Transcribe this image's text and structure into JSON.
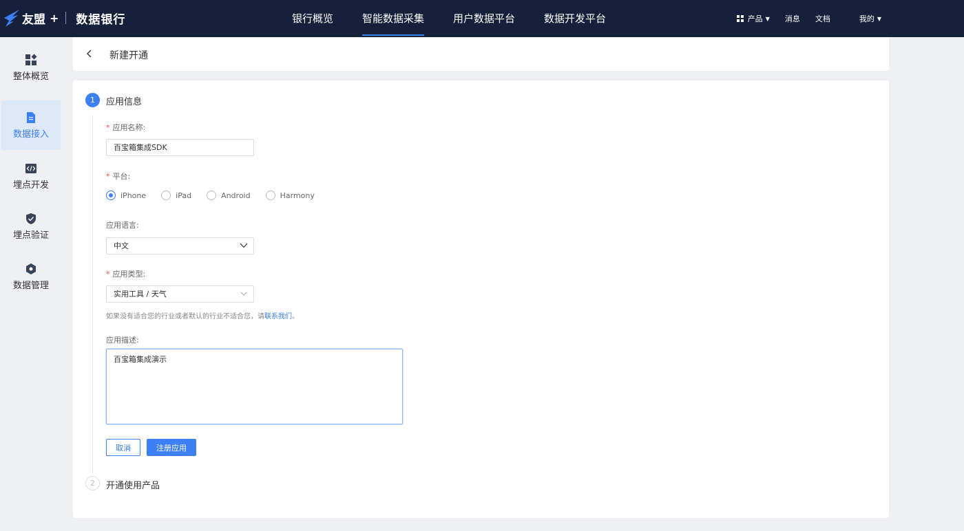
{
  "topbar": {
    "brand": "友盟",
    "brand_plus": "+",
    "product_name": "数据银行",
    "nav": [
      {
        "label": "银行概览",
        "active": false
      },
      {
        "label": "智能数据采集",
        "active": true
      },
      {
        "label": "用户数据平台",
        "active": false
      },
      {
        "label": "数据开发平台",
        "active": false
      }
    ],
    "products_label": "产品",
    "messages_label": "消息",
    "docs_label": "文档",
    "me_label": "我的",
    "accent_color": "#3d7ff5"
  },
  "sidebar": {
    "items": [
      {
        "label": "整体概览",
        "icon": "dashboard-icon",
        "active": false
      },
      {
        "label": "数据接入",
        "icon": "document-icon",
        "active": true
      },
      {
        "label": "埋点开发",
        "icon": "code-icon",
        "active": false
      },
      {
        "label": "埋点验证",
        "icon": "shield-check-icon",
        "active": false
      },
      {
        "label": "数据管理",
        "icon": "hexagon-icon",
        "active": false
      }
    ]
  },
  "header": {
    "title": "新建开通"
  },
  "steps": [
    {
      "number": "1",
      "title": "应用信息",
      "state": "active"
    },
    {
      "number": "2",
      "title": "开通使用产品",
      "state": "pending"
    }
  ],
  "form": {
    "app_name": {
      "label": "应用名称:",
      "value": "百宝箱集成SDK",
      "required": true
    },
    "platform": {
      "label": "平台:",
      "required": true,
      "options": [
        "iPhone",
        "iPad",
        "Android",
        "Harmony"
      ],
      "selected": "iPhone"
    },
    "language": {
      "label": "应用语言:",
      "value": "中文",
      "required": false
    },
    "app_type": {
      "label": "应用类型:",
      "value": "实用工具 / 天气",
      "required": true
    },
    "hint_text": "如果没有适合您的行业或者默认的行业不适合您，请",
    "hint_link": "联系我们",
    "hint_end": "。",
    "description": {
      "label": "应用描述:",
      "value": "百宝箱集成演示"
    },
    "cancel_label": "取消",
    "submit_label": "注册应用"
  }
}
